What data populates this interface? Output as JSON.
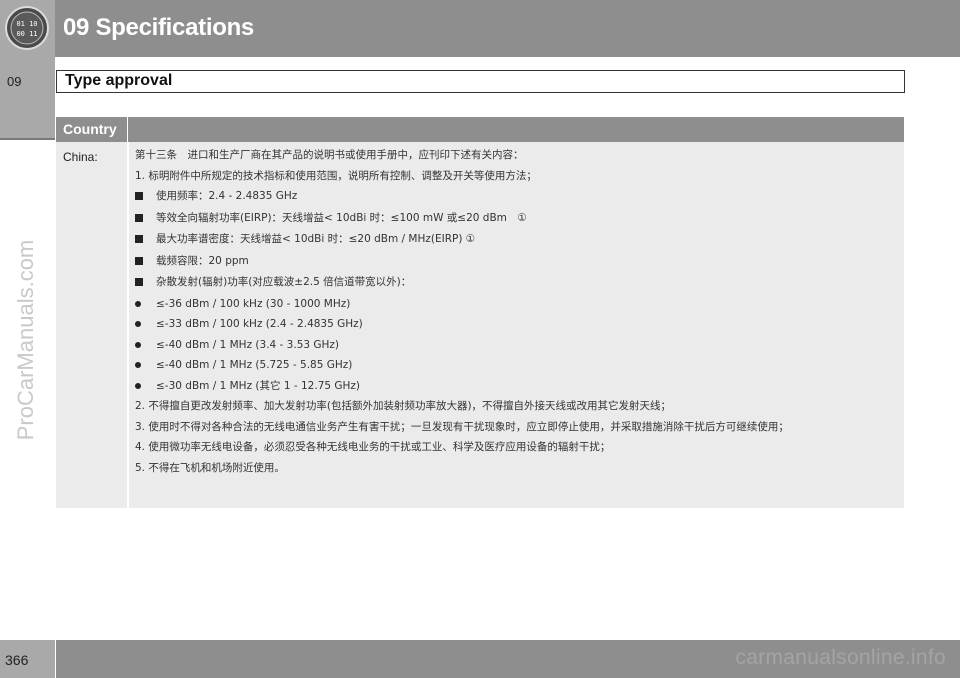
{
  "header": {
    "chapter_title": "09 Specifications",
    "chapter_number": "09",
    "icon": "clock-dial-icon",
    "icon_text_top": "01 10",
    "icon_text_bottom": "00 11"
  },
  "section": {
    "title": "Type approval"
  },
  "table": {
    "header_label": "Country",
    "country": "China:",
    "lines": [
      {
        "marker": "none",
        "text": "第十三条　进口和生产厂商在其产品的说明书或使用手册中，应刊印下述有关内容："
      },
      {
        "marker": "none",
        "text": "1. 标明附件中所规定的技术指标和使用范围，说明所有控制、调整及开关等使用方法；"
      },
      {
        "marker": "square",
        "text": "使用频率：2.4 - 2.4835 GHz"
      },
      {
        "marker": "square",
        "text": "等效全向辐射功率(EIRP)：天线增益< 10dBi 时：≤100 mW 或≤20 dBm　①"
      },
      {
        "marker": "square",
        "text": "最大功率谱密度：天线增益< 10dBi 时：≤20 dBm / MHz(EIRP) ①"
      },
      {
        "marker": "square",
        "text": "载频容限：20 ppm"
      },
      {
        "marker": "square",
        "text": "杂散发射(辐射)功率(对应载波±2.5 倍信道带宽以外)："
      },
      {
        "marker": "dot",
        "text": "≤-36 dBm / 100 kHz (30 - 1000 MHz)"
      },
      {
        "marker": "dot",
        "text": "≤-33 dBm / 100 kHz (2.4 - 2.4835 GHz)"
      },
      {
        "marker": "dot",
        "text": "≤-40 dBm / 1 MHz (3.4 - 3.53 GHz)"
      },
      {
        "marker": "dot",
        "text": "≤-40 dBm / 1 MHz (5.725 - 5.85 GHz)"
      },
      {
        "marker": "dot",
        "text": "≤-30 dBm / 1 MHz (其它 1 - 12.75 GHz)"
      },
      {
        "marker": "none",
        "text": "2. 不得擅自更改发射频率、加大发射功率(包括额外加装射频功率放大器)，不得擅自外接天线或改用其它发射天线；"
      },
      {
        "marker": "none",
        "wrap": true,
        "text": "3. 使用时不得对各种合法的无线电通信业务产生有害干扰；一旦发现有干扰现象时，应立即停止使用，并采取措施消除干扰后方可继续使用；"
      },
      {
        "marker": "none",
        "text": "4. 使用微功率无线电设备，必须忍受各种无线电业务的干扰或工业、科学及医疗应用设备的辐射干扰；"
      },
      {
        "marker": "none",
        "text": "5. 不得在飞机和机场附近使用。"
      }
    ]
  },
  "footer": {
    "page_number": "366"
  },
  "watermarks": {
    "side": "ProCarManuals.com",
    "footer": "carmanualsonline.info"
  },
  "colors": {
    "band": "#8e8e8e",
    "tab": "#a9a9a9",
    "table_body": "#ebebeb"
  }
}
